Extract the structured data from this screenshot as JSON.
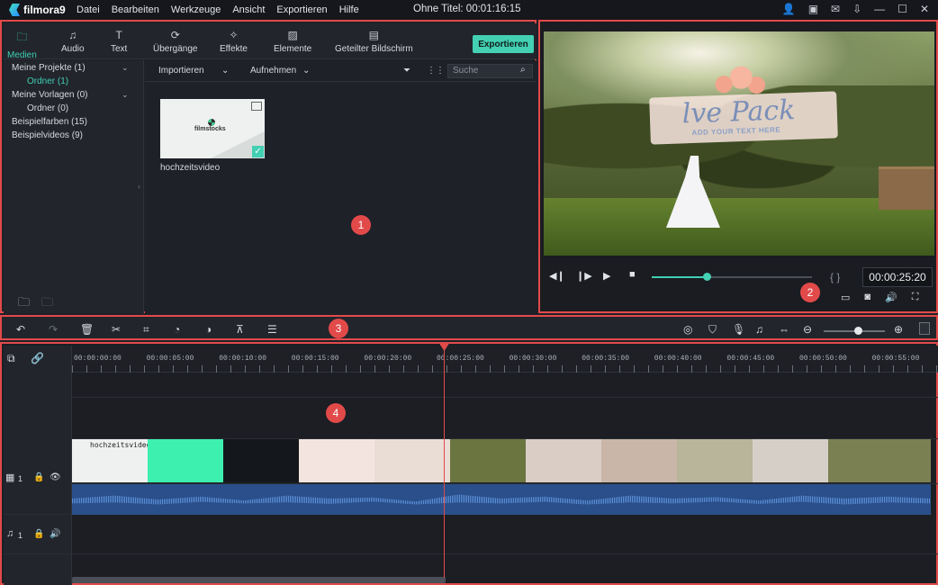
{
  "app": {
    "logo": "filmora9",
    "menu": [
      "Datei",
      "Bearbeiten",
      "Werkzeuge",
      "Ansicht",
      "Exportieren",
      "Hilfe"
    ],
    "window_title": "Ohne Titel: 00:01:16:15",
    "window_icons": [
      "user-icon",
      "save-icon",
      "mail-icon",
      "download-icon",
      "minimize-icon",
      "maximize-icon",
      "close-icon"
    ]
  },
  "media_panel": {
    "tabs": [
      {
        "label": "Medien",
        "icon": "folder-icon",
        "active": true
      },
      {
        "label": "Audio",
        "icon": "music-note-icon"
      },
      {
        "label": "Text",
        "icon": "text-icon"
      },
      {
        "label": "Übergänge",
        "icon": "transition-icon"
      },
      {
        "label": "Effekte",
        "icon": "effects-icon"
      },
      {
        "label": "Elemente",
        "icon": "elements-icon"
      },
      {
        "label": "Geteilter Bildschirm",
        "icon": "split-screen-icon"
      }
    ],
    "export_label": "Exportieren",
    "tree": [
      {
        "label": "Meine Projekte (1)"
      },
      {
        "label": "Ordner (1)",
        "selected": true
      },
      {
        "label": "Meine Vorlagen (0)"
      },
      {
        "label": "Ordner (0)"
      },
      {
        "label": "Beispielfarben (15)"
      },
      {
        "label": "Beispielvideos (9)"
      }
    ],
    "import_label": "Importieren",
    "record_label": "Aufnehmen",
    "search_placeholder": "Suche",
    "thumb_logo": "filmstocks",
    "thumb_label": "hochzeitsvideo",
    "badge": "1"
  },
  "preview": {
    "title_text": "lve Pack",
    "subtitle_text": "ADD YOUR TEXT HERE",
    "progress": 0.34,
    "timecode": "00:00:25:20",
    "badge": "2"
  },
  "toolbar": {
    "badge": "3",
    "zoom_level": 0.56
  },
  "timeline": {
    "badge": "4",
    "ticks": [
      "00:00:00:00",
      "00:00:05:00",
      "00:00:10:00",
      "00:00:15:00",
      "00:00:20:00",
      "00:00:25:00",
      "00:00:30:00",
      "00:00:35:00",
      "00:00:40:00",
      "00:00:45:00",
      "00:00:50:00",
      "00:00:55:00"
    ],
    "video_track_label": "1",
    "audio_track_label": "1",
    "clip_title": "hochzeitsvideo"
  },
  "colors": {
    "accent": "#43d0b3",
    "highlight": "#e24a4a"
  }
}
